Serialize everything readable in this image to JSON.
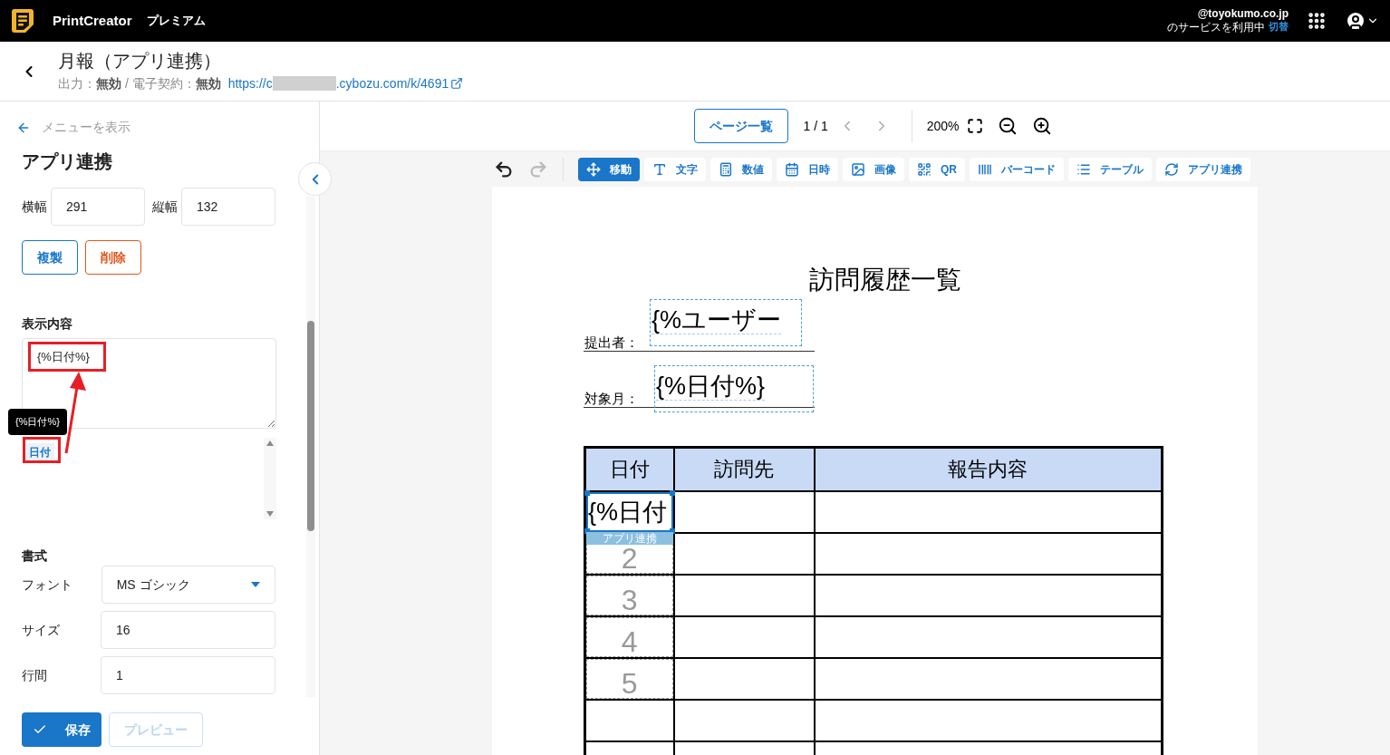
{
  "topbar": {
    "app_name": "PrintCreator",
    "plan": "プレミアム",
    "account_email": "@toyokumo.co.jp",
    "account_status": "のサービスを利用中",
    "switch_link": "切替"
  },
  "header": {
    "title": "月報（アプリ連携）",
    "status": "出力：**無効** / 電子契約：**無効**",
    "url_prefix": "https://c",
    "url_suffix": ".cybozu.com/k/4691"
  },
  "sidebar": {
    "back_link": "メニューを表示",
    "title": "アプリ連携",
    "size_fields": [
      {
        "label": "横幅",
        "value": "291"
      },
      {
        "label": "縦幅",
        "value": "132"
      }
    ],
    "actions": [
      {
        "label": "複製",
        "kind": "primary"
      },
      {
        "label": "削除",
        "kind": "danger"
      }
    ],
    "content": {
      "label": "表示内容",
      "value": "{%日付%}",
      "tooltip": "{%日付%}",
      "chips": [
        {
          "label": "日付"
        }
      ]
    },
    "format": {
      "label": "書式",
      "fields": [
        {
          "label": "フォント",
          "value": "MS ゴシック",
          "kind": "select"
        },
        {
          "label": "サイズ",
          "value": "16",
          "kind": "text"
        },
        {
          "label": "行間",
          "value": "1",
          "kind": "text"
        }
      ]
    },
    "save": {
      "label": "保存",
      "disabled": false
    },
    "preview": {
      "label": "プレビュー",
      "disabled": true
    }
  },
  "viewer": {
    "page_list": "ページ一覧",
    "page_indicator": "1 / 1",
    "zoom": "200%",
    "undo_disabled": false,
    "redo_disabled": true,
    "tools": [
      {
        "label": "移動",
        "kind": "move",
        "selected": true
      },
      {
        "label": "文字",
        "kind": "text",
        "selected": false
      },
      {
        "label": "数値",
        "kind": "number",
        "selected": false
      },
      {
        "label": "日時",
        "kind": "date",
        "selected": false
      },
      {
        "label": "画像",
        "kind": "image",
        "selected": false
      },
      {
        "label": "QR",
        "kind": "qr",
        "selected": false
      },
      {
        "label": "バーコード",
        "kind": "barcode",
        "selected": false
      },
      {
        "label": "テーブル",
        "kind": "table",
        "selected": false
      },
      {
        "label": "アプリ連携",
        "kind": "app",
        "selected": false
      }
    ]
  },
  "document": {
    "title": "訪問履歴一覧",
    "fields": [
      {
        "label": "提出者：",
        "placeholder": "{%ユーザー"
      },
      {
        "label": "対象月：",
        "placeholder": "{%日付%}"
      }
    ],
    "table": {
      "columns": [
        "日付",
        "訪問先",
        "報告内容"
      ],
      "rows": [
        {
          "kind": "selected",
          "text": "{%日付",
          "tag": "アプリ連携"
        },
        {
          "kind": "repeat",
          "text": "2"
        },
        {
          "kind": "repeat",
          "text": "3"
        },
        {
          "kind": "repeat",
          "text": "4"
        },
        {
          "kind": "repeat",
          "text": "5"
        },
        {
          "kind": "empty"
        },
        {
          "kind": "empty"
        }
      ]
    }
  }
}
